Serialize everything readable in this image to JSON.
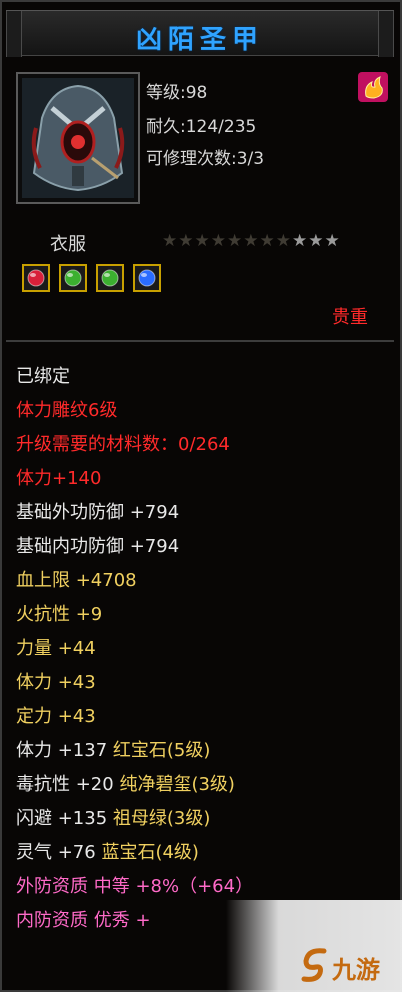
{
  "title": "凶陌圣甲",
  "stats": {
    "level": "等级:98",
    "durability": "耐久:124/235",
    "repair": "可修理次数:3/3"
  },
  "item_type": "衣服",
  "stars": {
    "total": 11,
    "lit": 3
  },
  "gems": [
    {
      "icon": "red-gem-icon",
      "color": "#d8203a"
    },
    {
      "icon": "green-gem-icon",
      "color": "#3cb030"
    },
    {
      "icon": "green-gem-icon",
      "color": "#3cb030"
    },
    {
      "icon": "blue-gem-icon",
      "color": "#2a6cff"
    }
  ],
  "rarity": "贵重",
  "details": [
    {
      "text": "已绑定",
      "color": "white"
    },
    {
      "text": "体力雕纹6级",
      "color": "red"
    },
    {
      "text": "升级需要的材料数：0/264",
      "color": "red"
    },
    {
      "text": "体力+140",
      "color": "red"
    },
    {
      "text": "基础外功防御 +794",
      "color": "white"
    },
    {
      "text": "基础内功防御 +794",
      "color": "white"
    },
    {
      "text": "血上限 +4708",
      "color": "yellow"
    },
    {
      "text": "火抗性 +9",
      "color": "yellow"
    },
    {
      "text": "力量 +44",
      "color": "yellow"
    },
    {
      "text": "体力 +43",
      "color": "yellow"
    },
    {
      "text": "定力 +43",
      "color": "yellow"
    },
    {
      "text": "体力 +137",
      "suffix": "红宝石(5级)",
      "color": "white",
      "suffix_color": "yellow"
    },
    {
      "text": "毒抗性 +20",
      "suffix": "纯净碧玺(3级)",
      "color": "white",
      "suffix_color": "yellow"
    },
    {
      "text": "闪避 +135",
      "suffix": "祖母绿(3级)",
      "color": "white",
      "suffix_color": "yellow"
    },
    {
      "text": "灵气 +76",
      "suffix": "蓝宝石(4级)",
      "color": "white",
      "suffix_color": "yellow"
    },
    {
      "text": "外防资质",
      "suffix": "中等 +8%（+64）",
      "color": "pink",
      "suffix_color": "pink"
    },
    {
      "text": "内防资质",
      "suffix": "优秀 +",
      "color": "pink",
      "suffix_color": "pink"
    }
  ],
  "watermark": "九游"
}
